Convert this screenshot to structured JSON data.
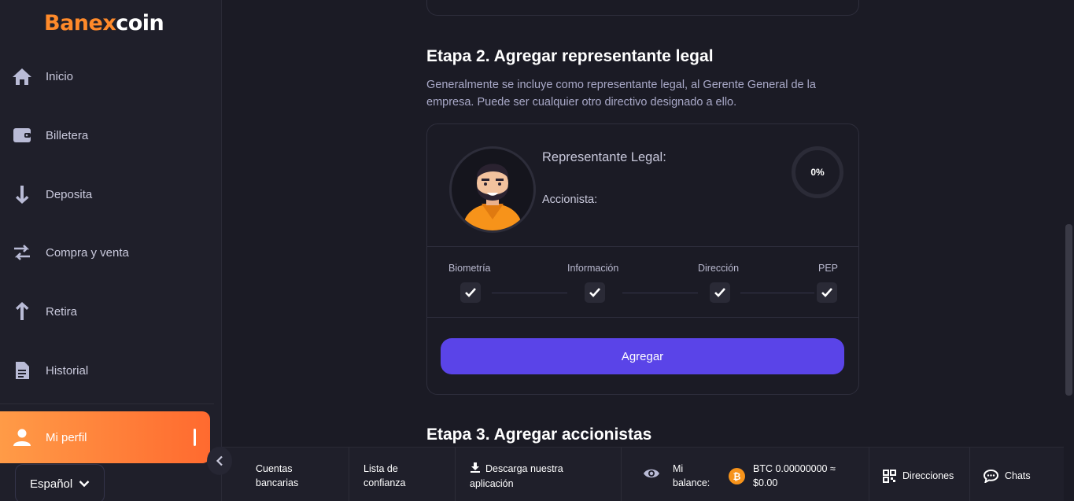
{
  "brand": {
    "part1": "Banex",
    "part2": "coin"
  },
  "sidebar": {
    "items": [
      {
        "label": "Inicio",
        "icon": "home-icon"
      },
      {
        "label": "Billetera",
        "icon": "wallet-icon"
      },
      {
        "label": "Deposita",
        "icon": "arrow-down-icon"
      },
      {
        "label": "Compra y venta",
        "icon": "swap-arrows-icon"
      },
      {
        "label": "Retira",
        "icon": "arrow-up-icon"
      },
      {
        "label": "Historial",
        "icon": "document-icon"
      },
      {
        "label": "Mi perfil",
        "icon": "user-icon",
        "active": true
      }
    ],
    "language": "Español"
  },
  "main": {
    "step2": {
      "title": "Etapa 2. Agregar representante legal",
      "description": "Generalmente se incluye como representante legal, al Gerente General de la empresa. Puede ser cualquier otro directivo designado a ello."
    },
    "card": {
      "rep_label": "Representante Legal:",
      "acc_label": "Accionista:",
      "progress_text": "0%",
      "progress_value": 0,
      "steps": [
        {
          "label": "Biometría",
          "done": true
        },
        {
          "label": "Información",
          "done": true
        },
        {
          "label": "Dirección",
          "done": true
        },
        {
          "label": "PEP",
          "done": true
        }
      ],
      "add_button": "Agregar"
    },
    "step3": {
      "title": "Etapa 3. Agregar accionistas"
    }
  },
  "footer": {
    "bank_accounts": [
      "Cuentas",
      "bancarias"
    ],
    "trust_list": [
      "Lista de",
      "confianza"
    ],
    "download": [
      "Descarga nuestra",
      "aplicación"
    ],
    "balance_label": [
      "Mi",
      "balance:"
    ],
    "balance_value": [
      "BTC 0.00000000 ≈",
      "$0.00"
    ],
    "addresses": "Direcciones",
    "chats": "Chats"
  },
  "colors": {
    "accent_orange": "#ff7a35",
    "primary_button": "#5a44e8",
    "background": "#1b1b25",
    "btc": "#f7931a"
  }
}
